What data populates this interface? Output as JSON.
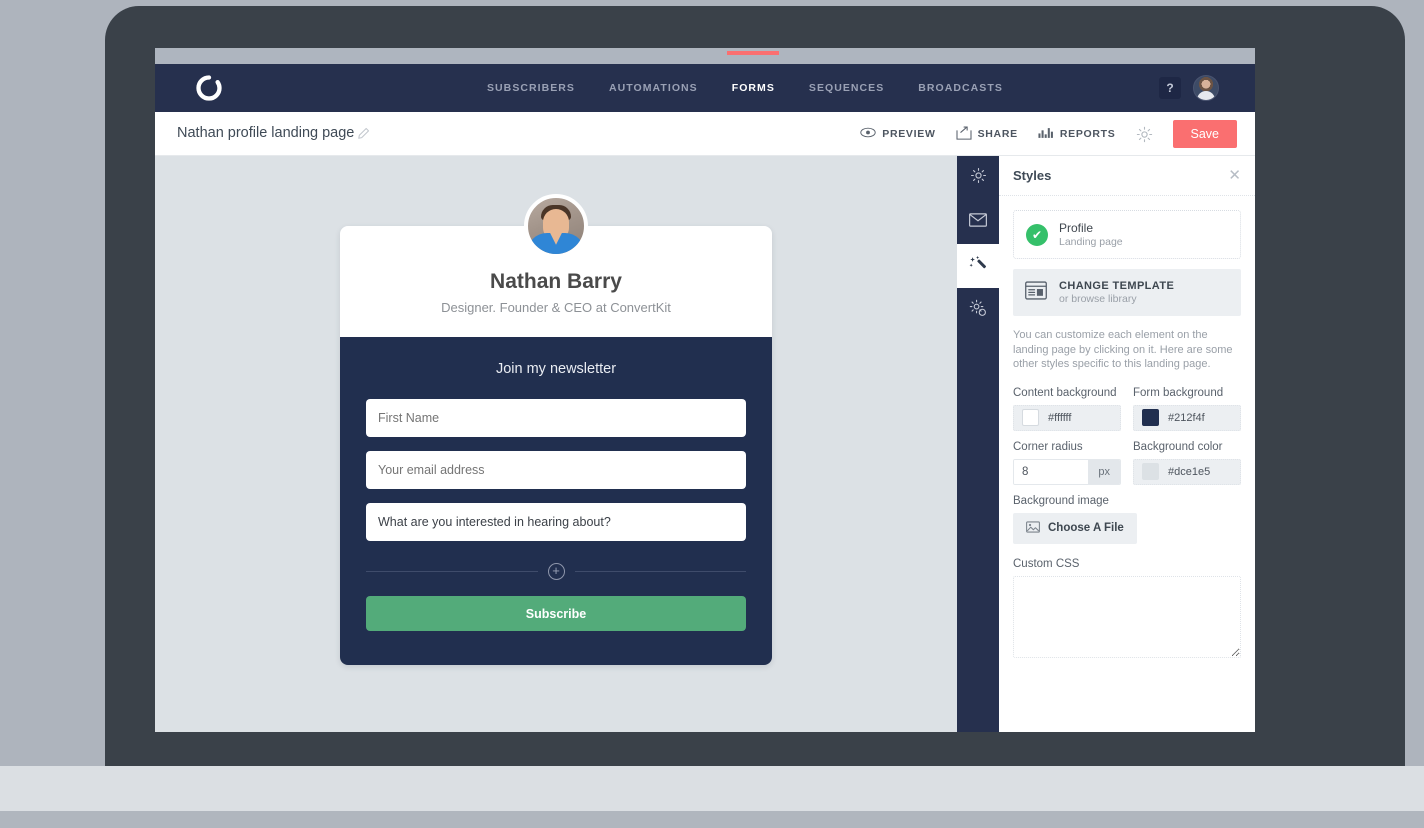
{
  "app": {
    "logo_icon": "convertkit-logo-icon",
    "nav_items": [
      {
        "label": "SUBSCRIBERS",
        "active": false
      },
      {
        "label": "AUTOMATIONS",
        "active": false
      },
      {
        "label": "FORMS",
        "active": true
      },
      {
        "label": "SEQUENCES",
        "active": false
      },
      {
        "label": "BROADCASTS",
        "active": false
      }
    ],
    "help_label": "?",
    "avatar_icon": "user-avatar-icon",
    "accent_color": "#fa6f70",
    "nav_background": "#26304e"
  },
  "subheader": {
    "page_title": "Nathan profile landing page",
    "edit_icon": "pencil-icon",
    "actions": [
      {
        "label": "PREVIEW",
        "icon": "eye-icon"
      },
      {
        "label": "SHARE",
        "icon": "share-icon"
      },
      {
        "label": "REPORTS",
        "icon": "bar-chart-icon"
      }
    ],
    "settings_icon": "gear-icon",
    "save_label": "Save"
  },
  "canvas": {
    "background_color": "#dce1e5",
    "profile": {
      "avatar_icon": "profile-photo-icon",
      "name": "Nathan Barry",
      "tagline": "Designer. Founder & CEO at ConvertKit"
    },
    "form": {
      "heading": "Join my newsletter",
      "fields": [
        {
          "placeholder": "First Name",
          "value": "",
          "name": "first-name-field"
        },
        {
          "placeholder": "Your email address",
          "value": "",
          "name": "email-field"
        },
        {
          "placeholder": "",
          "value": "What are you interested in hearing about?",
          "name": "interest-field"
        }
      ],
      "add_field_icon": "plus-circle-icon",
      "submit_label": "Subscribe",
      "form_background": "#212f4f",
      "submit_color": "#53ab7a"
    }
  },
  "rail": {
    "items": [
      {
        "icon": "gear-icon",
        "name": "rail-item-settings",
        "active": false
      },
      {
        "icon": "envelope-icon",
        "name": "rail-item-email",
        "active": false
      },
      {
        "icon": "magic-wand-icon",
        "name": "rail-item-styles",
        "active": true
      },
      {
        "icon": "gear-plus-icon",
        "name": "rail-item-advanced",
        "active": false
      }
    ]
  },
  "panel": {
    "title": "Styles",
    "close_icon": "close-icon",
    "template": {
      "check_icon": "check-icon",
      "name": "Profile",
      "subtitle": "Landing page"
    },
    "change_template": {
      "icon": "template-icon",
      "title": "CHANGE TEMPLATE",
      "subtitle": "or browse library"
    },
    "description": "You can customize each element on the landing page by clicking on it. Here are some other styles specific to this landing page.",
    "content_background": {
      "label": "Content background",
      "value": "#ffffff",
      "swatch": "#ffffff"
    },
    "form_background": {
      "label": "Form background",
      "value": "#212f4f",
      "swatch": "#212f4f"
    },
    "corner_radius": {
      "label": "Corner radius",
      "value": "8",
      "unit": "px"
    },
    "page_background": {
      "label": "Background color",
      "value": "#dce1e5",
      "swatch": "#dce1e5"
    },
    "background_image": {
      "label": "Background image",
      "button_label": "Choose A File",
      "icon": "image-icon"
    },
    "custom_css": {
      "label": "Custom CSS",
      "value": "",
      "placeholder": ""
    }
  }
}
